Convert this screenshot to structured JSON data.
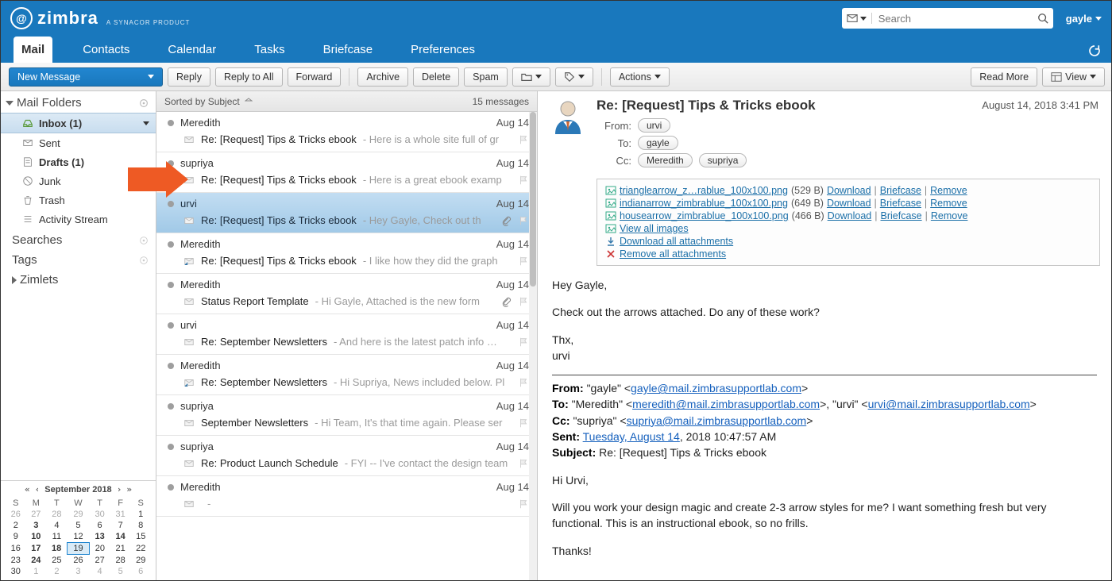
{
  "brand": {
    "name": "zimbra",
    "sub": "A SYNACOR PRODUCT"
  },
  "search": {
    "placeholder": "Search"
  },
  "user": {
    "name": "gayle"
  },
  "nav": {
    "tabs": [
      "Mail",
      "Contacts",
      "Calendar",
      "Tasks",
      "Briefcase",
      "Preferences"
    ],
    "active": 0
  },
  "toolbar": {
    "newmsg": "New Message",
    "reply": "Reply",
    "replyall": "Reply to All",
    "forward": "Forward",
    "archive": "Archive",
    "delete": "Delete",
    "spam": "Spam",
    "actions": "Actions",
    "readmore": "Read More",
    "view": "View"
  },
  "sidebar": {
    "folders_hdr": "Mail Folders",
    "inbox": "Inbox (1)",
    "sent": "Sent",
    "drafts": "Drafts (1)",
    "junk": "Junk",
    "trash": "Trash",
    "activity": "Activity Stream",
    "searches": "Searches",
    "tags": "Tags",
    "zimlets": "Zimlets"
  },
  "calendar": {
    "title": "September 2018",
    "dow": [
      "S",
      "M",
      "T",
      "W",
      "T",
      "F",
      "S"
    ],
    "weeks": [
      [
        {
          "d": "26",
          "m": true
        },
        {
          "d": "27",
          "m": true
        },
        {
          "d": "28",
          "m": true
        },
        {
          "d": "29",
          "m": true
        },
        {
          "d": "30",
          "m": true
        },
        {
          "d": "31",
          "m": true
        },
        {
          "d": "1"
        }
      ],
      [
        {
          "d": "2"
        },
        {
          "d": "3",
          "b": true
        },
        {
          "d": "4"
        },
        {
          "d": "5"
        },
        {
          "d": "6"
        },
        {
          "d": "7"
        },
        {
          "d": "8"
        }
      ],
      [
        {
          "d": "9"
        },
        {
          "d": "10",
          "b": true
        },
        {
          "d": "11"
        },
        {
          "d": "12"
        },
        {
          "d": "13",
          "b": true
        },
        {
          "d": "14",
          "b": true
        },
        {
          "d": "15"
        }
      ],
      [
        {
          "d": "16"
        },
        {
          "d": "17",
          "b": true
        },
        {
          "d": "18",
          "b": true
        },
        {
          "d": "19",
          "t": true
        },
        {
          "d": "20"
        },
        {
          "d": "21"
        },
        {
          "d": "22"
        }
      ],
      [
        {
          "d": "23"
        },
        {
          "d": "24",
          "b": true
        },
        {
          "d": "25"
        },
        {
          "d": "26"
        },
        {
          "d": "27"
        },
        {
          "d": "28"
        },
        {
          "d": "29"
        }
      ],
      [
        {
          "d": "30"
        },
        {
          "d": "1",
          "m": true
        },
        {
          "d": "2",
          "m": true
        },
        {
          "d": "3",
          "m": true
        },
        {
          "d": "4",
          "m": true
        },
        {
          "d": "5",
          "m": true
        },
        {
          "d": "6",
          "m": true
        }
      ]
    ]
  },
  "list": {
    "sort": "Sorted by Subject",
    "count": "15 messages",
    "items": [
      {
        "from": "Meredith",
        "date": "Aug 14",
        "subject": "Re: [Request] Tips & Tricks ebook",
        "preview": "Here is a whole site full of gr"
      },
      {
        "from": "supriya",
        "date": "Aug 14",
        "subject": "Re: [Request] Tips & Tricks ebook",
        "preview": "Here is a great ebook examp"
      },
      {
        "from": "urvi",
        "date": "Aug 14",
        "subject": "Re: [Request] Tips & Tricks ebook",
        "preview": "Hey Gayle, Check out th",
        "selected": true,
        "attachment": true
      },
      {
        "from": "Meredith",
        "date": "Aug 14",
        "subject": "Re: [Request] Tips & Tricks ebook",
        "preview": "I like how they did the graph",
        "replied": true
      },
      {
        "from": "Meredith",
        "date": "Aug 14",
        "subject": "Status Report Template",
        "preview": "Hi Gayle, Attached is the new form",
        "attachment": true
      },
      {
        "from": "urvi",
        "date": "Aug 14",
        "subject": "Re: September Newsletters",
        "preview": "And here is the latest patch info …"
      },
      {
        "from": "Meredith",
        "date": "Aug 14",
        "subject": "Re: September Newsletters",
        "preview": "Hi Supriya, News included below. Pl",
        "replied": true
      },
      {
        "from": "supriya",
        "date": "Aug 14",
        "subject": "September Newsletters",
        "preview": "Hi Team, It's that time again. Please ser"
      },
      {
        "from": "supriya",
        "date": "Aug 14",
        "subject": "Re: Product Launch Schedule",
        "preview": "FYI -- I've contact the design team"
      },
      {
        "from": "Meredith",
        "date": "Aug 14",
        "subject": "",
        "preview": ""
      }
    ]
  },
  "message": {
    "date": "August 14, 2018 3:41 PM",
    "subject": "Re: [Request] Tips & Tricks ebook",
    "from_lbl": "From:",
    "to_lbl": "To:",
    "cc_lbl": "Cc:",
    "from": "urvi",
    "to": [
      "gayle"
    ],
    "cc": [
      "Meredith",
      "supriya"
    ],
    "attachments": [
      {
        "name": "trianglearrow_z…rablue_100x100.png",
        "size": "(529 B)"
      },
      {
        "name": "indianarrow_zimbrablue_100x100.png",
        "size": "(649 B)"
      },
      {
        "name": "housearrow_zimbrablue_100x100.png",
        "size": "(466 B)"
      }
    ],
    "attach_actions": {
      "dl": "Download",
      "bc": "Briefcase",
      "rm": "Remove"
    },
    "attach_links": {
      "viewimg": "View all images",
      "dlall": "Download all attachments",
      "rmall": "Remove all attachments"
    },
    "body": {
      "l1": "Hey Gayle,",
      "l2": "Check out the arrows attached. Do any of these work?",
      "l3": "Thx,",
      "l4": "urvi"
    },
    "quoted": {
      "from_lbl": "From:",
      "from_name": "\"gayle\" <",
      "from_email": "gayle@mail.zimbrasupportlab.com",
      "from_end": ">",
      "to_lbl": "To:",
      "to_text": "\"Meredith\" <",
      "to_email": "meredith@mail.zimbrasupportlab.com",
      "to_mid": ">, \"urvi\" <",
      "to_email2": "urvi@mail.zimbrasupportlab.com",
      "to_end": ">",
      "cc_lbl": "Cc:",
      "cc_text": "\"supriya\" <",
      "cc_email": "supriya@mail.zimbrasupportlab.com",
      "cc_end": ">",
      "sent_lbl": "Sent:",
      "sent_link": "Tuesday, August 14",
      "sent_rest": ", 2018 10:47:57 AM",
      "subj_lbl": "Subject:",
      "subj": "Re: [Request] Tips & Tricks ebook",
      "b1": "Hi Urvi,",
      "b2": "Will you work your design magic and create 2-3 arrow styles for me? I want something fresh but very functional. This is an instructional ebook, so no frills.",
      "b3": "Thanks!"
    }
  }
}
